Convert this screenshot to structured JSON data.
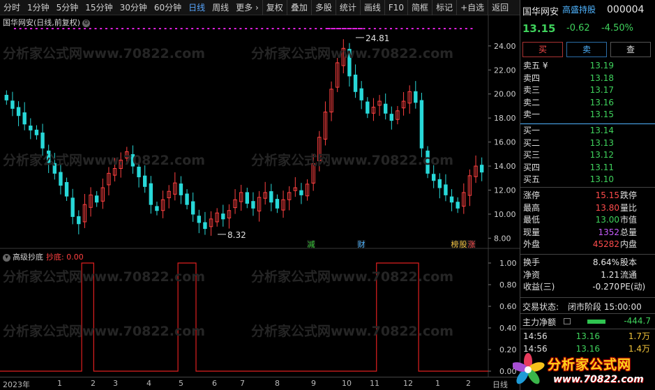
{
  "toolbar": {
    "periods": [
      "分时",
      "1分钟",
      "5分钟",
      "15分钟",
      "30分钟",
      "60分钟",
      "日线",
      "周线",
      "更多 ›"
    ],
    "active": "日线",
    "tools": [
      "复权",
      "叠加",
      "多股",
      "统计",
      "画线",
      "F10",
      "简框",
      "标记",
      "+自选",
      "返回"
    ]
  },
  "kline": {
    "title": "国华网安(日线,前复权)",
    "y_ticks": [
      "24.00",
      "22.00",
      "20.00",
      "18.00",
      "16.00",
      "14.00",
      "12.00",
      "10.00",
      "8.00"
    ],
    "high_label": "24.81",
    "low_label": "8.32",
    "markers": [
      "减",
      "财",
      "榜",
      "股",
      "涨"
    ]
  },
  "indicator": {
    "name": "高级抄底",
    "value_label": "抄底: 0.00",
    "y_ticks": [
      "1.00",
      "0.80",
      "0.60",
      "0.40",
      "0.20",
      "0.00"
    ]
  },
  "x_axis": {
    "labels": [
      "2023年",
      "1",
      "2",
      "3",
      "4",
      "5",
      "6",
      "7",
      "8",
      "9",
      "10",
      "11",
      "12",
      "1",
      "2"
    ],
    "period": "日线"
  },
  "watermark": "分析家公式网www.70822.com",
  "quote": {
    "name": "国华网安",
    "tag": "高盛持股",
    "code": "000004",
    "price": "13.15",
    "change": "-0.62",
    "change_pct": "-4.50%",
    "buttons": [
      "买",
      "卖",
      "查"
    ]
  },
  "orderbook": {
    "asks": [
      {
        "label": "卖五 ¥",
        "price": "13.19"
      },
      {
        "label": "卖四",
        "price": "13.18"
      },
      {
        "label": "卖三",
        "price": "13.17"
      },
      {
        "label": "卖二",
        "price": "13.16"
      },
      {
        "label": "卖一",
        "price": "13.15"
      }
    ],
    "bids": [
      {
        "label": "买一",
        "price": "13.14"
      },
      {
        "label": "买二",
        "price": "13.13"
      },
      {
        "label": "买三",
        "price": "13.12"
      },
      {
        "label": "买四",
        "price": "13.11"
      },
      {
        "label": "买五",
        "price": "13.10"
      }
    ]
  },
  "stats": [
    {
      "l": "涨停",
      "v": "15.15",
      "r": "跌停"
    },
    {
      "l": "最高",
      "v": "13.80",
      "r": "量比"
    },
    {
      "l": "最低",
      "v": "13.00",
      "r": "市值"
    },
    {
      "l": "现量",
      "v": "1352",
      "r": "总量"
    },
    {
      "l": "外盘",
      "v": "45282",
      "r": "内盘"
    }
  ],
  "stats2": [
    {
      "l": "换手",
      "v": "8.64%",
      "r": "股本"
    },
    {
      "l": "净资",
      "v": "1.21",
      "r": "流通"
    },
    {
      "l": "收益(三)",
      "v": "-0.270",
      "r": "PE(动)"
    }
  ],
  "status": {
    "label": "交易状态:",
    "value": "闭市阶段 15:00:00"
  },
  "mainflow": {
    "label": "主力净额",
    "value": "-444.7"
  },
  "ticks": [
    {
      "t": "14:56",
      "p": "13.16",
      "v": "1.7万"
    },
    {
      "t": "14:56",
      "p": "13.16",
      "v": "1.4万"
    }
  ],
  "logo": {
    "text": "分析家公式网",
    "url": "www.70822.com"
  },
  "chart_data": {
    "type": "candlestick",
    "ylim": [
      7.5,
      25.5
    ],
    "x": [
      "2023-01",
      "2023-02",
      "2023-03",
      "2023-04",
      "2023-05",
      "2023-06",
      "2023-07",
      "2023-08",
      "2023-09",
      "2023-10",
      "2023-11",
      "2023-12",
      "2024-01",
      "2024-02"
    ],
    "close": [
      19.5,
      18.8,
      18.2,
      17.5,
      17.0,
      16.6,
      15.5,
      14.3,
      13.4,
      12.4,
      11.5,
      9.8,
      9.2,
      10.8,
      11.6,
      11.0,
      12.2,
      13.4,
      13.8,
      14.5,
      15.2,
      14.0,
      13.1,
      12.3,
      10.8,
      10.3,
      11.2,
      11.9,
      12.6,
      11.6,
      10.8,
      10.0,
      9.3,
      8.8,
      9.6,
      10.1,
      9.6,
      10.3,
      11.2,
      11.8,
      10.9,
      10.5,
      11.4,
      11.8,
      11.0,
      10.5,
      11.2,
      11.8,
      12.2,
      11.6,
      12.5,
      14.2,
      16.4,
      18.5,
      20.4,
      22.6,
      23.8,
      21.5,
      20.2,
      19.5,
      18.4,
      18.9,
      19.4,
      18.4,
      17.8,
      18.6,
      19.4,
      20.2,
      19.3,
      15.5,
      13.4,
      12.8,
      12.2,
      11.6,
      11.0,
      10.5,
      11.8,
      13.2,
      14.0,
      13.5
    ],
    "indicator_spikes_x_index": [
      13,
      14,
      29,
      30,
      31,
      62,
      63,
      64,
      65,
      66,
      67,
      68
    ],
    "indicator_values": "0 or 1"
  }
}
